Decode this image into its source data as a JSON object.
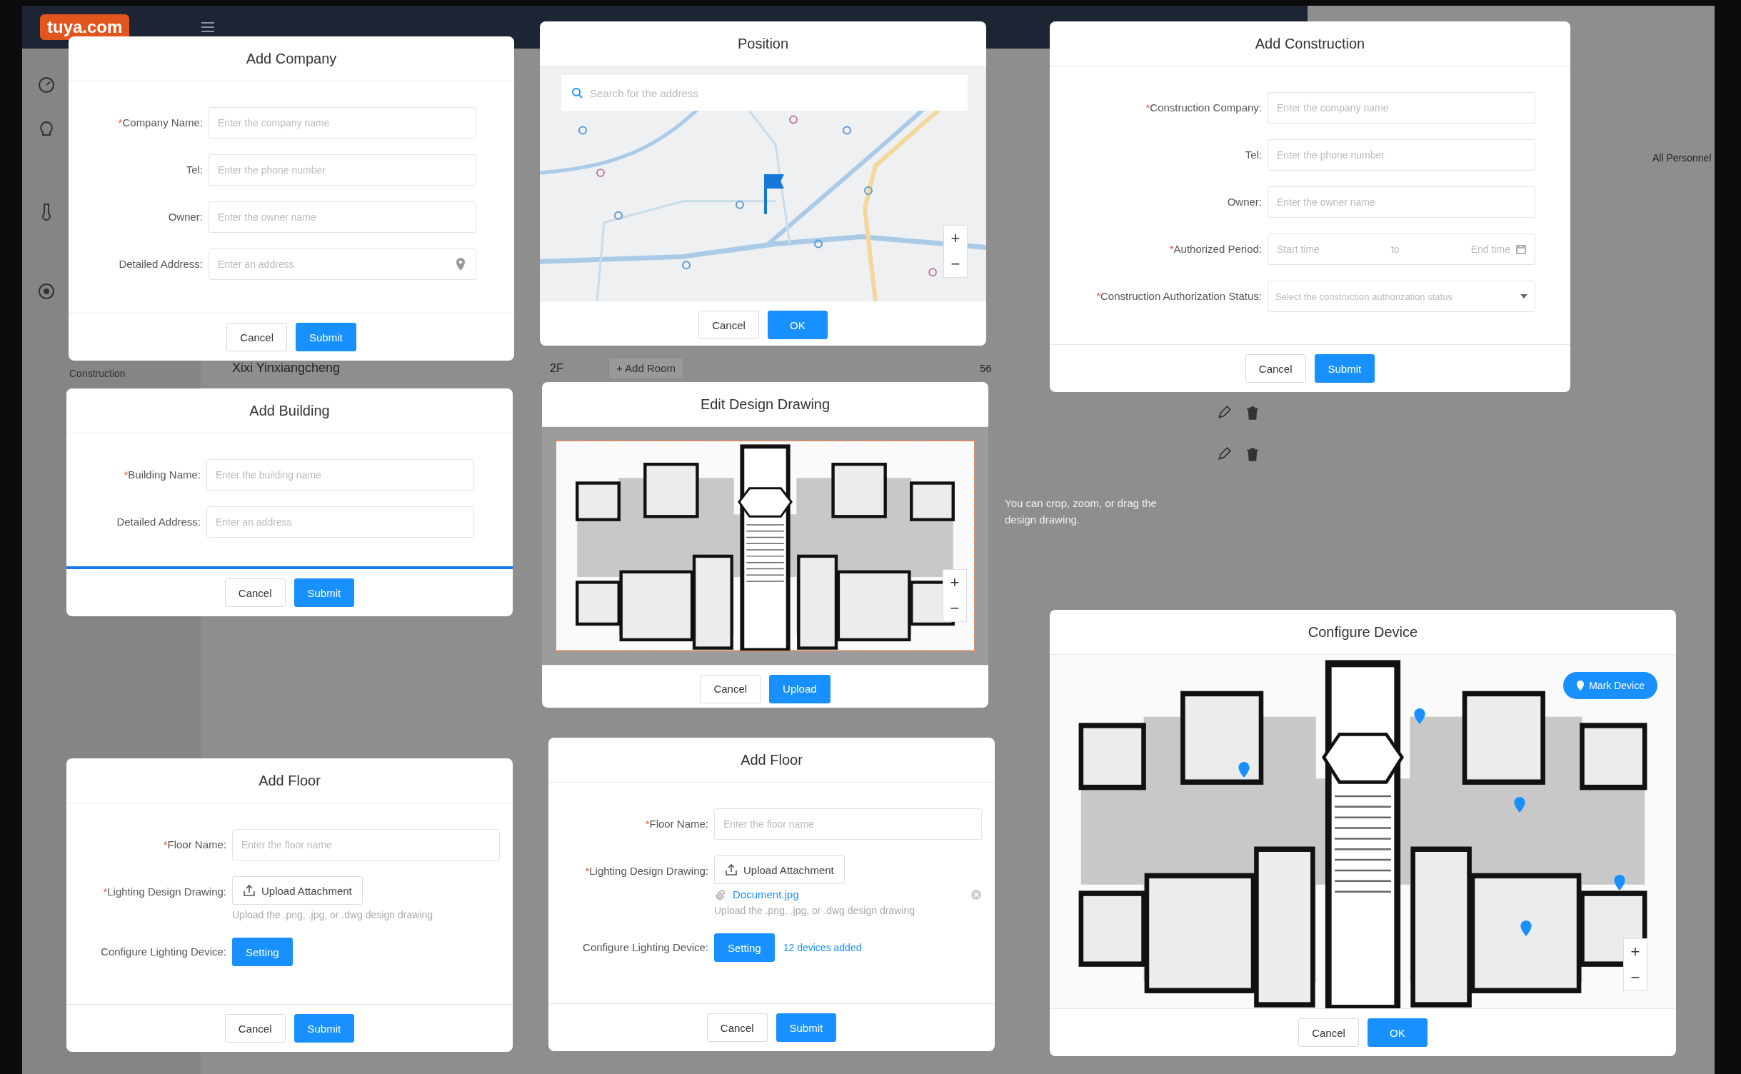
{
  "app": {
    "logo": "tuya.com",
    "menu_label": "Construction",
    "project_name": "Xixi Yinxiangcheng",
    "floor_row": {
      "floor": "2F",
      "add_room": "+ Add Room",
      "count": "56"
    },
    "side_label": "All Personnel",
    "hint": "You can crop, zoom, or drag the design drawing."
  },
  "dialogs": [
    {
      "kind": "form",
      "title": "Add Company",
      "accent_line": false,
      "fields": [
        {
          "kind": "text",
          "mark": "*",
          "label": "Company Name:",
          "placeholder": "Enter the company name"
        },
        {
          "kind": "text",
          "label": "Tel:",
          "placeholder": "Enter the phone number"
        },
        {
          "kind": "text",
          "label": "Owner:",
          "placeholder": "Enter the owner name"
        },
        {
          "kind": "address",
          "label": "Detailed Address:",
          "placeholder": "Enter an address"
        }
      ],
      "buttons": [
        {
          "label": "Cancel",
          "primary": false
        },
        {
          "label": "Submit",
          "primary": true
        }
      ]
    },
    {
      "kind": "map",
      "title": "Position",
      "search": {
        "placeholder": "Search for the address"
      },
      "zoom": [
        "+",
        "−"
      ],
      "buttons": [
        {
          "label": "Cancel",
          "primary": false
        },
        {
          "label": "OK",
          "primary": true
        }
      ]
    },
    {
      "kind": "form",
      "title": "Add Construction",
      "accent_line": false,
      "fields": [
        {
          "kind": "text",
          "mark": "*",
          "label": "Construction Company:",
          "placeholder": "Enter the company name"
        },
        {
          "kind": "text",
          "label": "Tel:",
          "placeholder": "Enter the phone number"
        },
        {
          "kind": "text",
          "label": "Owner:",
          "placeholder": "Enter the owner name"
        },
        {
          "kind": "range",
          "mark": "*",
          "label": "Authorized Period:",
          "start": "Start time",
          "separator": "to",
          "end": "End time"
        },
        {
          "kind": "select",
          "mark": "*",
          "label": "Construction Authorization Status:",
          "placeholder": "Select the construction authorization status"
        }
      ],
      "buttons": [
        {
          "label": "Cancel",
          "primary": false
        },
        {
          "label": "Submit",
          "primary": true
        }
      ]
    },
    {
      "kind": "form",
      "title": "Add Building",
      "accent_line": true,
      "fields": [
        {
          "kind": "text",
          "mark": "*",
          "label": "Building Name:",
          "placeholder": "Enter the building name"
        },
        {
          "kind": "text",
          "label": "Detailed Address:",
          "placeholder": "Enter an address"
        }
      ],
      "buttons": [
        {
          "label": "Cancel",
          "primary": false
        },
        {
          "label": "Submit",
          "primary": true
        }
      ]
    },
    {
      "kind": "drawing",
      "title": "Edit Design Drawing",
      "zoom": [
        "+",
        "−"
      ],
      "buttons": [
        {
          "label": "Cancel",
          "primary": false
        },
        {
          "label": "Upload",
          "primary": true
        }
      ]
    },
    {
      "kind": "form",
      "title": "Add Floor",
      "accent_line": false,
      "fields": [
        {
          "kind": "text",
          "mark": "*",
          "label": "Floor Name:",
          "placeholder": "Enter the floor name"
        },
        {
          "kind": "upload",
          "mark": "*",
          "label": "Lighting Design Drawing:",
          "button": "Upload Attachment",
          "hint": "Upload the .png, .jpg, or .dwg design drawing"
        },
        {
          "kind": "setting",
          "label": "Configure Lighting Device:",
          "button": "Setting"
        }
      ],
      "buttons": [
        {
          "label": "Cancel",
          "primary": false
        },
        {
          "label": "Submit",
          "primary": true
        }
      ]
    },
    {
      "kind": "form",
      "title": "Add Floor",
      "accent_line": false,
      "fields": [
        {
          "kind": "text",
          "mark": "*",
          "label": "Floor Name:",
          "placeholder": "Enter the floor name"
        },
        {
          "kind": "upload",
          "mark": "*",
          "label": "Lighting Design Drawing:",
          "button": "Upload Attachment",
          "file": "Document.jpg",
          "hint": "Upload the .png, .jpg, or .dwg design drawing"
        },
        {
          "kind": "setting",
          "label": "Configure Lighting Device:",
          "button": "Setting",
          "note": "12 devices added"
        }
      ],
      "buttons": [
        {
          "label": "Cancel",
          "primary": false
        },
        {
          "label": "Submit",
          "primary": true
        }
      ]
    },
    {
      "kind": "devices",
      "title": "Configure Device",
      "mark_button": "Mark Device",
      "zoom": [
        "+",
        "−"
      ],
      "buttons": [
        {
          "label": "Cancel",
          "primary": false
        },
        {
          "label": "OK",
          "primary": true
        }
      ]
    }
  ]
}
